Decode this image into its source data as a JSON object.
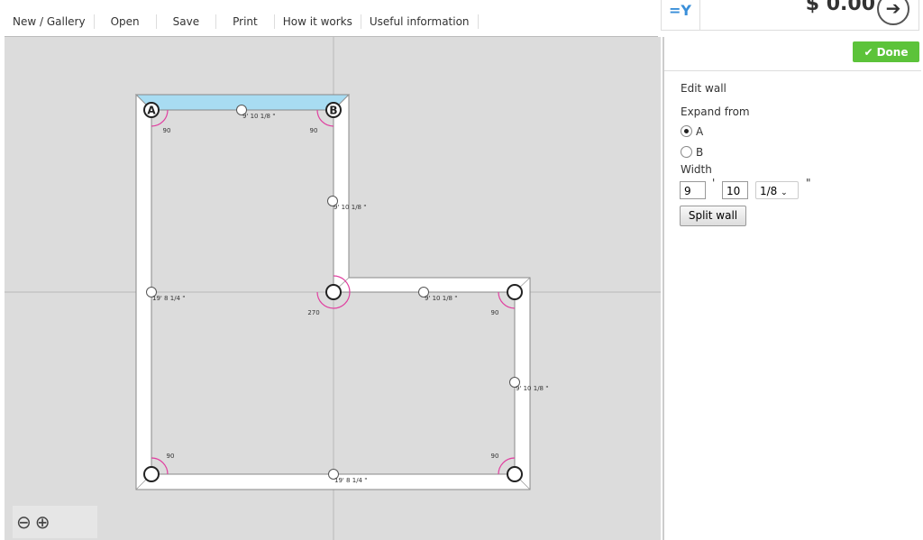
{
  "menu": [
    "New / Gallery",
    "Open",
    "Save",
    "Print",
    "How it works",
    "Useful information"
  ],
  "price": "$ 0.00",
  "done_label": "Done",
  "panel": {
    "title": "Edit wall",
    "expand_from": "Expand from",
    "options": [
      "A",
      "B"
    ],
    "selected": "A",
    "width_label": "Width",
    "feet": "9",
    "inches": "10",
    "fraction": "1/8",
    "feet_mark": "'",
    "inch_mark": "\"",
    "split_label": "Split wall"
  },
  "plan": {
    "corners": [
      {
        "label": "A",
        "angle": "90"
      },
      {
        "label": "B",
        "angle": "90"
      },
      {
        "label": "",
        "angle": "270"
      },
      {
        "label": "",
        "angle": "90"
      },
      {
        "label": "",
        "angle": "90"
      },
      {
        "label": "",
        "angle": "90"
      }
    ],
    "walls": [
      "9' 10 1/8 \"",
      "9' 10 1/8 \"",
      "9' 10 1/8 \"",
      "9' 10 1/8 \"",
      "19' 8 1/4 \"",
      "19' 8 1/4 \""
    ],
    "selected_wall_color": "#a8dcf2",
    "angle_arc_color": "#e040a0"
  }
}
